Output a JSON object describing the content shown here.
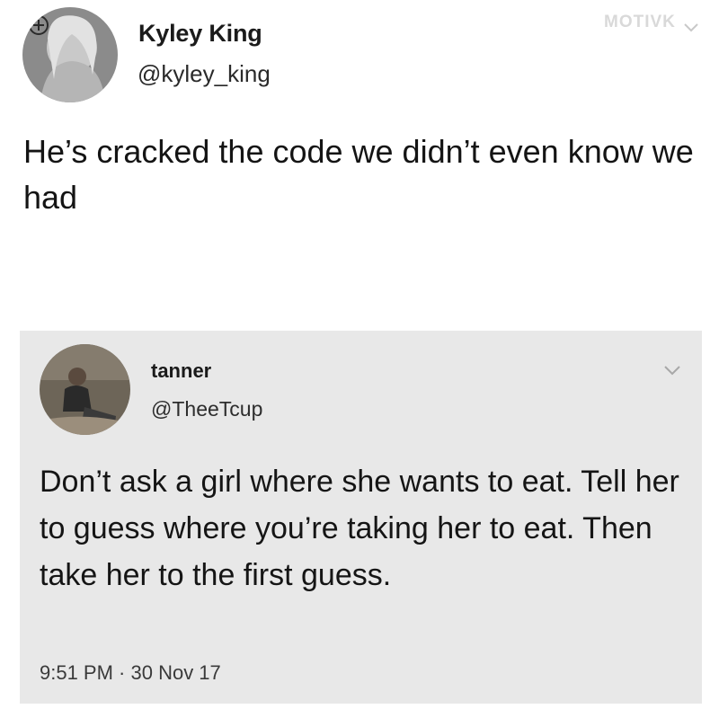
{
  "watermark": "MOTIVK",
  "top_tweet": {
    "display_name": "Kyley King",
    "handle": "@kyley_king",
    "text": "He’s cracked the code we didn’t even know we had"
  },
  "quoted_tweet": {
    "display_name": "tanner",
    "handle": "@TheeTcup",
    "text": "Don’t ask a girl where she wants to eat. Tell her to guess where you’re taking her to eat. Then take her to the first guess.",
    "timestamp": "9:51 PM · 30 Nov 17"
  },
  "icons": {
    "top_menu": "chevron-down-icon",
    "quote_menu": "chevron-down-icon"
  }
}
